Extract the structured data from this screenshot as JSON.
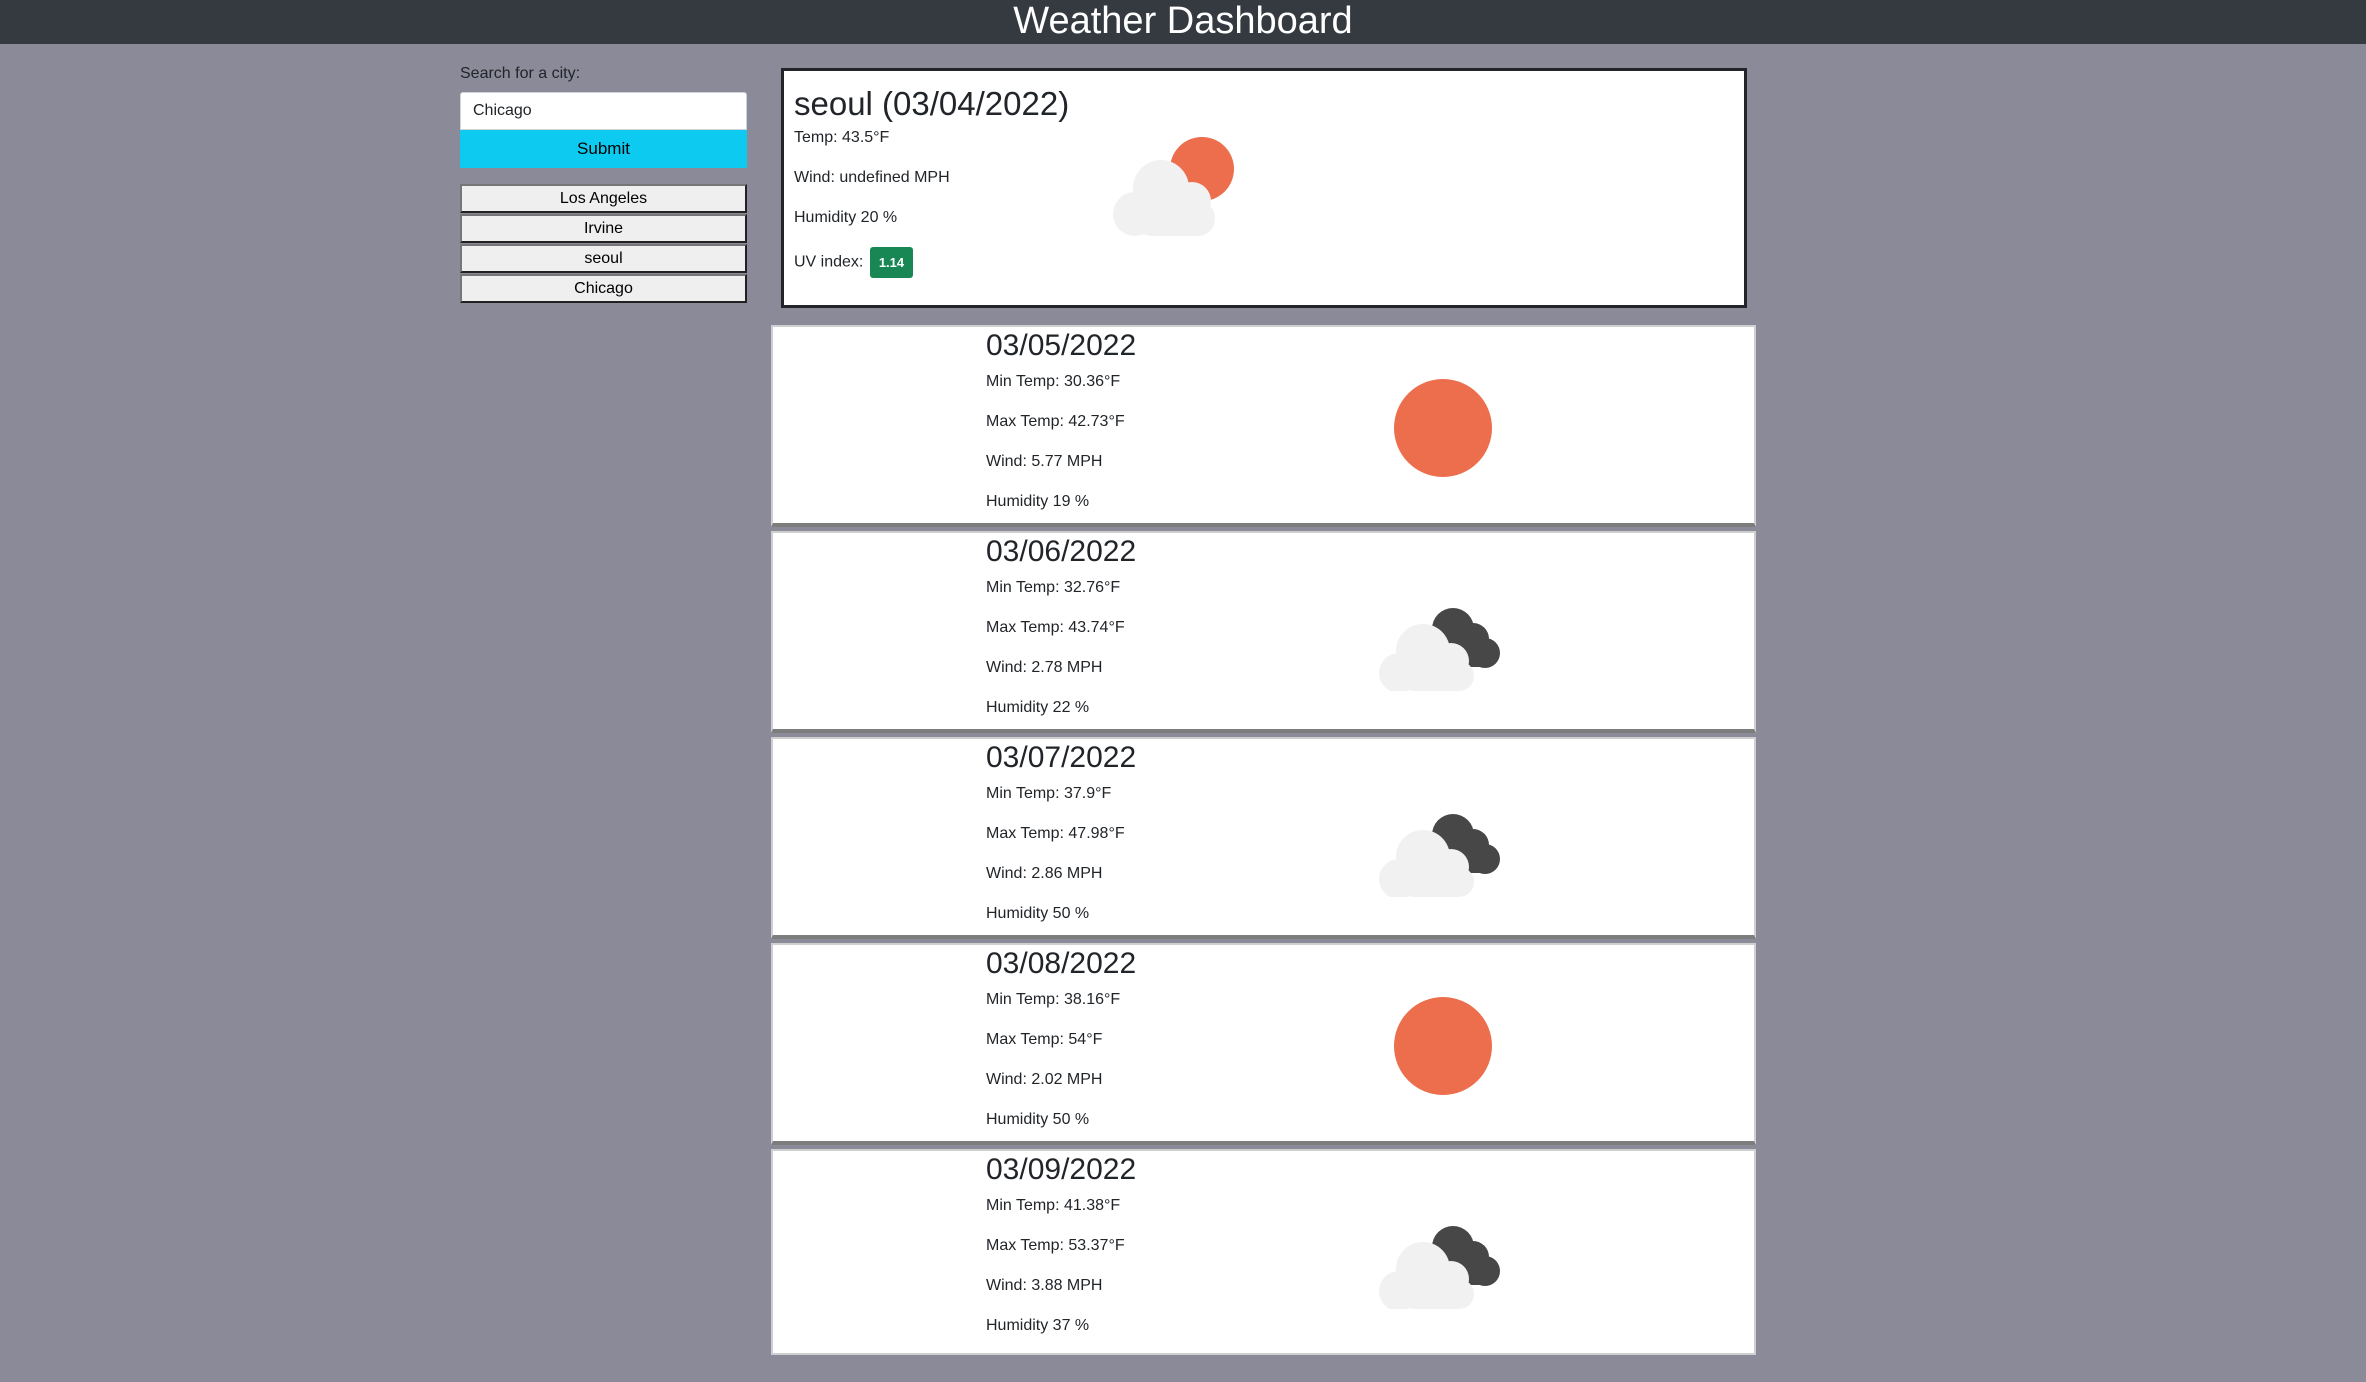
{
  "header": {
    "title": "Weather Dashboard"
  },
  "search": {
    "label": "Search for a city:",
    "value": "Chicago",
    "submit_label": "Submit"
  },
  "history": [
    "Los Angeles",
    "Irvine",
    "seoul",
    "Chicago"
  ],
  "current": {
    "title": "seoul (03/04/2022)",
    "temp": "Temp: 43.5°F",
    "wind": "Wind: undefined MPH",
    "humidity": "Humidity 20 %",
    "uv_label": "UV index:",
    "uv_value": "1.14",
    "icon": "partly-cloudy-icon"
  },
  "forecast": [
    {
      "date": "03/05/2022",
      "min": "Min Temp: 30.36°F",
      "max": "Max Temp: 42.73°F",
      "wind": "Wind: 5.77 MPH",
      "humidity": "Humidity 19 %",
      "icon": "sun-icon"
    },
    {
      "date": "03/06/2022",
      "min": "Min Temp: 32.76°F",
      "max": "Max Temp: 43.74°F",
      "wind": "Wind: 2.78 MPH",
      "humidity": "Humidity 22 %",
      "icon": "cloudy-icon"
    },
    {
      "date": "03/07/2022",
      "min": "Min Temp: 37.9°F",
      "max": "Max Temp: 47.98°F",
      "wind": "Wind: 2.86 MPH",
      "humidity": "Humidity 50 %",
      "icon": "cloudy-icon"
    },
    {
      "date": "03/08/2022",
      "min": "Min Temp: 38.16°F",
      "max": "Max Temp: 54°F",
      "wind": "Wind: 2.02 MPH",
      "humidity": "Humidity 50 %",
      "icon": "sun-icon"
    },
    {
      "date": "03/09/2022",
      "min": "Min Temp: 41.38°F",
      "max": "Max Temp: 53.37°F",
      "wind": "Wind: 3.88 MPH",
      "humidity": "Humidity 37 %",
      "icon": "cloudy-icon"
    }
  ],
  "colors": {
    "background": "#8a8a98",
    "header": "#343a40",
    "submit": "#0dcaf0",
    "uv_badge": "#198754",
    "sun": "#ec6e4c",
    "cloud_light": "#f1f1f1",
    "cloud_dark": "#474747"
  }
}
